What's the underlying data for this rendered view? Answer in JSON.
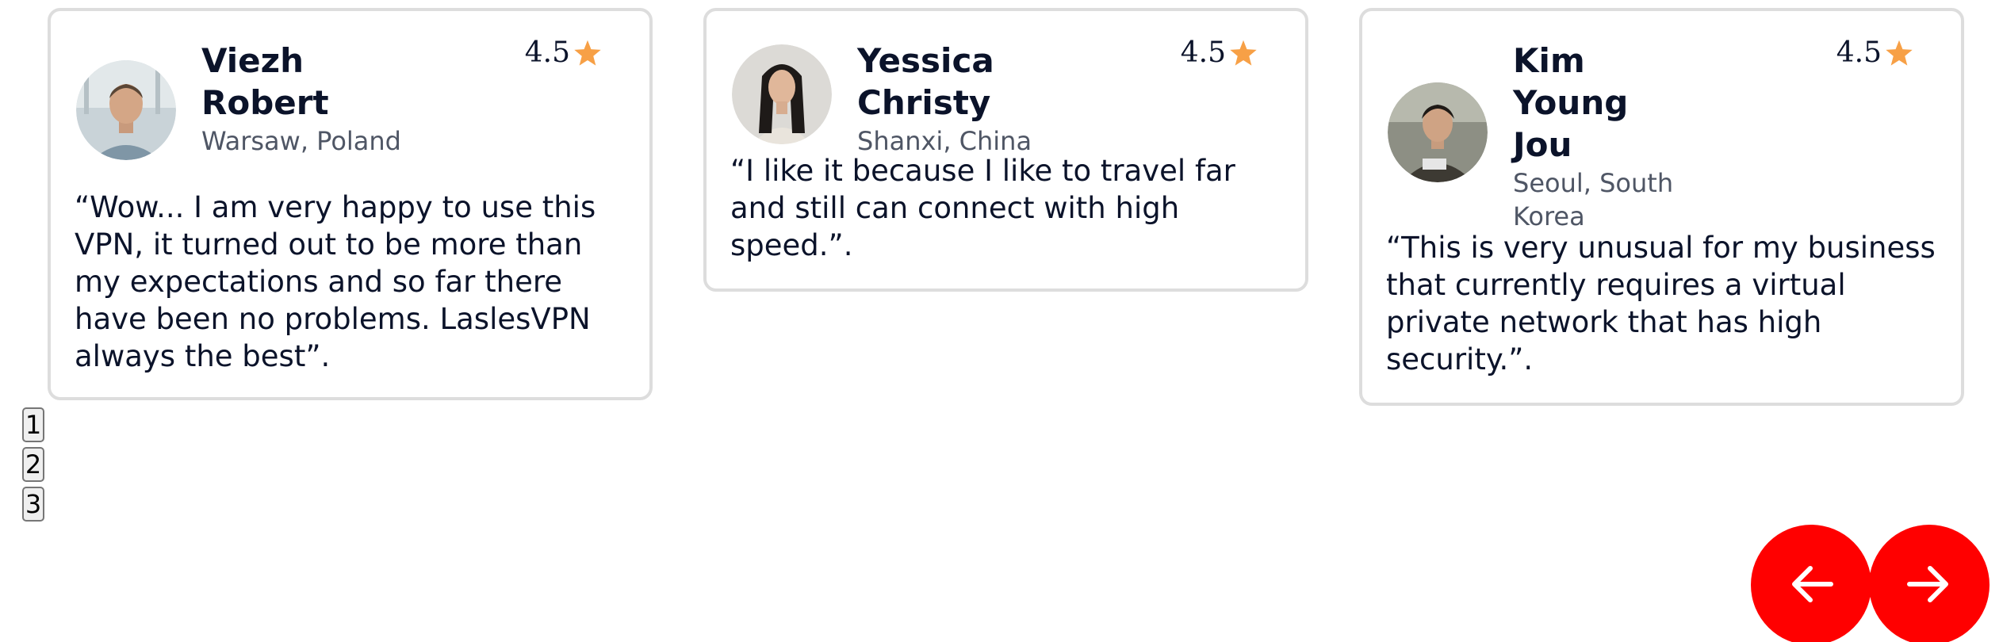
{
  "testimonials": [
    {
      "name": "Viezh Robert",
      "location": "Warsaw, Poland",
      "rating": "4.5",
      "quote": "“Wow... I am very happy to use this VPN, it turned out to be more than my expectations and so far there have been no problems. LaslesVPN always the best”."
    },
    {
      "name": "Yessica Christy",
      "location": "Shanxi, China",
      "rating": "4.5",
      "quote": "“I like it because I like to travel far and still can connect with high speed.”."
    },
    {
      "name": "Kim Young Jou",
      "location": "Seoul, South Korea",
      "rating": "4.5",
      "quote": "“This is very unusual for my business that currently requires a virtual private network that has high security.”."
    }
  ],
  "pagination": [
    "1",
    "2",
    "3"
  ],
  "icons": {
    "star": "star-icon",
    "prev": "arrow-left-icon",
    "next": "arrow-right-icon"
  },
  "colors": {
    "star": "#f7a046",
    "nav_button": "#ff0000",
    "card_border": "#dddddd",
    "text": "#0b132a",
    "muted": "#4f5665"
  }
}
